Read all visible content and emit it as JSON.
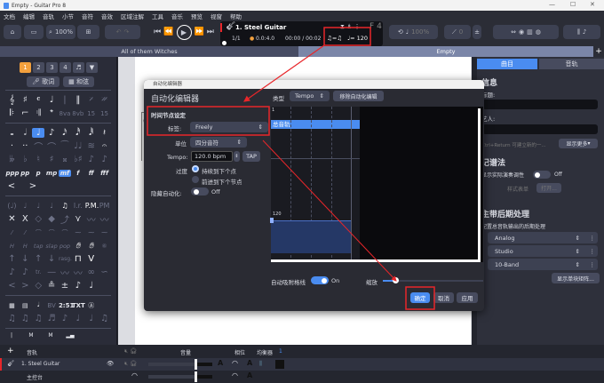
{
  "window": {
    "title": "Empty - Guitar Pro 8"
  },
  "menu": [
    "文档",
    "编辑",
    "音轨",
    "小节",
    "音符",
    "音效",
    "区域注解",
    "工具",
    "音乐",
    "预览",
    "视窗",
    "帮助"
  ],
  "toolbar": {
    "zoom": "100%",
    "track_name": "1. Steel Guitar",
    "bar": "1/1",
    "position": "0.0:4.0",
    "time": "00:00 / 00:02",
    "tempo": "♩= 120",
    "rhythm": "♫=♫",
    "key": "F",
    "time_sig": "4",
    "speed": "100%",
    "pitch": "0"
  },
  "tabs": [
    {
      "label": "All of them Witches",
      "active": false
    },
    {
      "label": "Empty",
      "active": true
    }
  ],
  "palette": {
    "voices": [
      "1",
      "2",
      "3",
      "4"
    ],
    "lyrics": "歌词",
    "chords": "和弦"
  },
  "right_panel": {
    "tabs": [
      "曲目",
      "音轨"
    ],
    "info_heading": "信息",
    "title_label": "标题:",
    "artist_label": "艺人:",
    "hint": "Ctrl+Return 可建立新的一...",
    "show_more": "显示更多",
    "notation_heading": "记谱法",
    "concert_tone": "显示实际演奏调性",
    "concert_tone_state": "Off",
    "stylesheet": "样式表单",
    "open": "打开...",
    "mastering_heading": "主带后期处理",
    "mastering_sub": "配置总音轨输出的后期处理",
    "effects": [
      "Analog",
      "Studio",
      "10-Band"
    ],
    "show_matrix": "显示单块矩阵..."
  },
  "dialog": {
    "window_title": "自动化编辑器",
    "heading": "自动化编辑器",
    "type_label": "类型",
    "type_value": "Tempo",
    "remove": "移除自动化编辑",
    "section": "时间节点设定",
    "label_label": "标签:",
    "label_value": "Freely",
    "unit_label": "单位",
    "unit_value": "四分音符",
    "tempo_label": "Tempo:",
    "tempo_value": "120.0 bpm",
    "tap": "TAP",
    "transition_label": "过度",
    "transition_options": [
      {
        "label": "持续到下个点",
        "selected": true
      },
      {
        "label": "前进到下个节点",
        "selected": false
      }
    ],
    "hide_label": "隐藏自动化:",
    "hide_state": "Off",
    "graph_track": "总音轨",
    "graph_bar": "1",
    "graph_value": "120",
    "snap_label": "自动吸附格线",
    "snap_state": "On",
    "zoom_label": "缩放",
    "zoom_level": 0.12,
    "ok": "确定",
    "cancel": "取消",
    "apply": "应用"
  },
  "tracks": {
    "header_track": "音轨",
    "header_volume": "音量",
    "header_pan": "相位",
    "header_eq": "均衡器",
    "header_num": "1",
    "rows": [
      {
        "name": "1. Steel Guitar",
        "volume": 0.72
      },
      {
        "name": "主控台",
        "volume": 0.72
      }
    ]
  },
  "colors": {
    "accent": "#4a8cf0",
    "annotation": "#e8262a",
    "palette_active": "#f2a03d"
  }
}
